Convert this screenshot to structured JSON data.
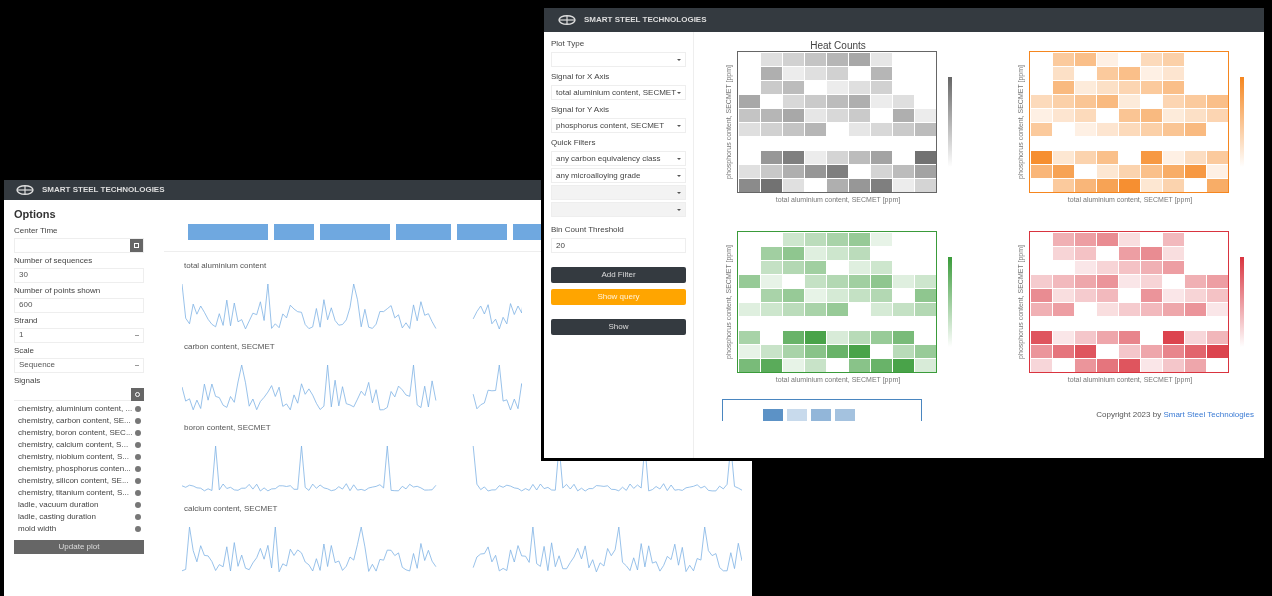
{
  "back_window": {
    "brand": "SMART STEEL TECHNOLOGIES",
    "sidebar": {
      "title": "Options",
      "fields": [
        {
          "label": "Center Time",
          "kind": "date"
        },
        {
          "label": "Number of sequences",
          "kind": "input",
          "value": "30"
        },
        {
          "label": "Number of points shown",
          "kind": "input",
          "value": "600"
        },
        {
          "label": "Strand",
          "kind": "select",
          "value": "1"
        },
        {
          "label": "Scale",
          "kind": "select",
          "value": "Sequence"
        }
      ],
      "signals_label": "Signals",
      "signals": [
        "chemistry, aluminium content, ...",
        "chemistry, carbon content, SE...",
        "chemistry, boron content, SEC...",
        "chemistry, calcium content, S...",
        "chemistry, niobium content, S...",
        "chemistry, phosphorus conten...",
        "chemistry, silicon content, SE...",
        "chemistry, titanium content, S...",
        "ladle, vacuum duration",
        "ladle, casting duration",
        "mold width"
      ],
      "button": "Update plot"
    },
    "charts": [
      {
        "title": "total aluminium content"
      },
      {
        "title": "carbon content, SECMET"
      },
      {
        "title": "boron content, SECMET"
      },
      {
        "title": "calcium content, SECMET"
      }
    ]
  },
  "front_window": {
    "brand": "SMART STEEL TECHNOLOGIES",
    "sidebar": {
      "fields": [
        {
          "label": "Plot Type"
        },
        {
          "label": "Signal for X Axis",
          "value": "total aluminium content, SECMET"
        },
        {
          "label": "Signal for Y Axis",
          "value": "phosphorus content, SECMET"
        }
      ],
      "quick_filters_label": "Quick Filters",
      "filters": [
        {
          "value": "any carbon equivalency class",
          "disabled": false
        },
        {
          "value": "any microalloying grade",
          "disabled": false
        },
        {
          "disabled": true
        },
        {
          "disabled": true
        }
      ],
      "threshold_label": "Bin Count Threshold",
      "threshold": "20",
      "buttons": [
        {
          "label": "Add Filter",
          "kind": "dark"
        },
        {
          "label": "Show query",
          "kind": "accent"
        },
        {
          "label": "Show",
          "kind": "dark"
        }
      ]
    },
    "heatmaps": [
      {
        "title": "Heat Counts",
        "color": "#666666",
        "xlabel": "total aluminium content, SECMET [ppm]",
        "ylabel": "phosphorus content, SECMET [ppm]"
      },
      {
        "color": "#f5861f",
        "xlabel": "total aluminium content, SECMET [ppm]",
        "ylabel": "phosphorus content, SECMET [ppm]"
      },
      {
        "color": "#3a9b3a",
        "xlabel": "total aluminium content, SECMET [ppm]",
        "ylabel": "phosphorus content, SECMET [ppm]"
      },
      {
        "color": "#d9343f",
        "xlabel": "total aluminium content, SECMET [ppm]",
        "ylabel": "phosphorus content, SECMET [ppm]"
      }
    ],
    "partial_heatmap": {
      "color": "#4a86c0"
    },
    "footer": {
      "text": "Copyright 2023 by",
      "link": "Smart Steel Technologies"
    }
  }
}
